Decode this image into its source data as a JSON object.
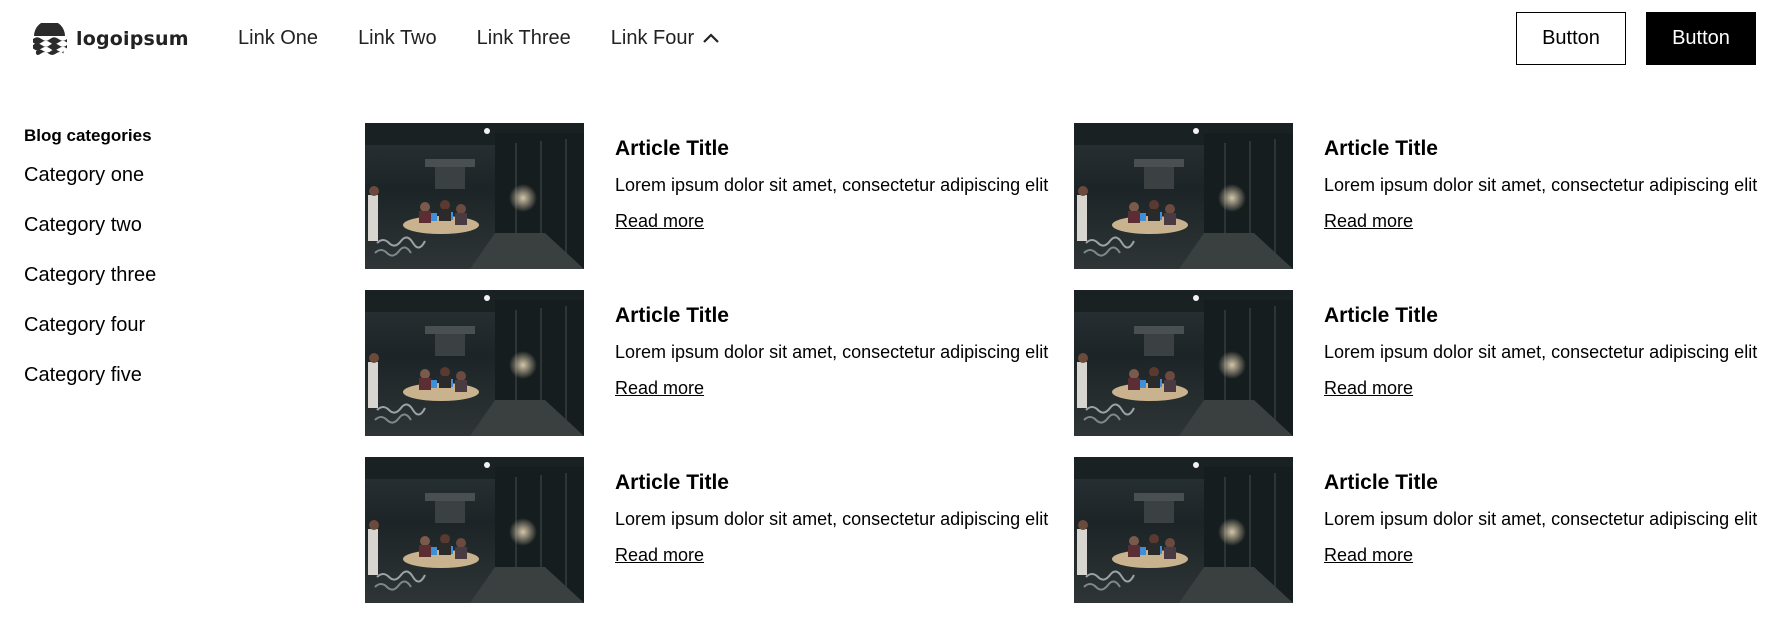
{
  "header": {
    "logo_text": "logoipsum",
    "nav": [
      {
        "label": "Link One"
      },
      {
        "label": "Link Two"
      },
      {
        "label": "Link Three"
      },
      {
        "label": "Link Four"
      }
    ],
    "buttons": {
      "secondary": "Button",
      "primary": "Button"
    }
  },
  "sidebar": {
    "title": "Blog categories",
    "categories": [
      "Category one",
      "Category two",
      "Category three",
      "Category four",
      "Category five"
    ]
  },
  "articles": [
    {
      "title": "Article Title",
      "excerpt": "Lorem ipsum dolor sit amet, consectetur adipiscing elit",
      "link": "Read more"
    },
    {
      "title": "Article Title",
      "excerpt": "Lorem ipsum dolor sit amet, consectetur adipiscing elit",
      "link": "Read more"
    },
    {
      "title": "Article Title",
      "excerpt": "Lorem ipsum dolor sit amet, consectetur adipiscing elit",
      "link": "Read more"
    },
    {
      "title": "Article Title",
      "excerpt": "Lorem ipsum dolor sit amet, consectetur adipiscing elit",
      "link": "Read more"
    },
    {
      "title": "Article Title",
      "excerpt": "Lorem ipsum dolor sit amet, consectetur adipiscing elit",
      "link": "Read more"
    },
    {
      "title": "Article Title",
      "excerpt": "Lorem ipsum dolor sit amet, consectetur adipiscing elit",
      "link": "Read more"
    }
  ],
  "icons": {
    "logo": "wave-logo-icon",
    "dropdown": "chevron-up-icon",
    "thumbnail": "office-meeting-photo"
  }
}
